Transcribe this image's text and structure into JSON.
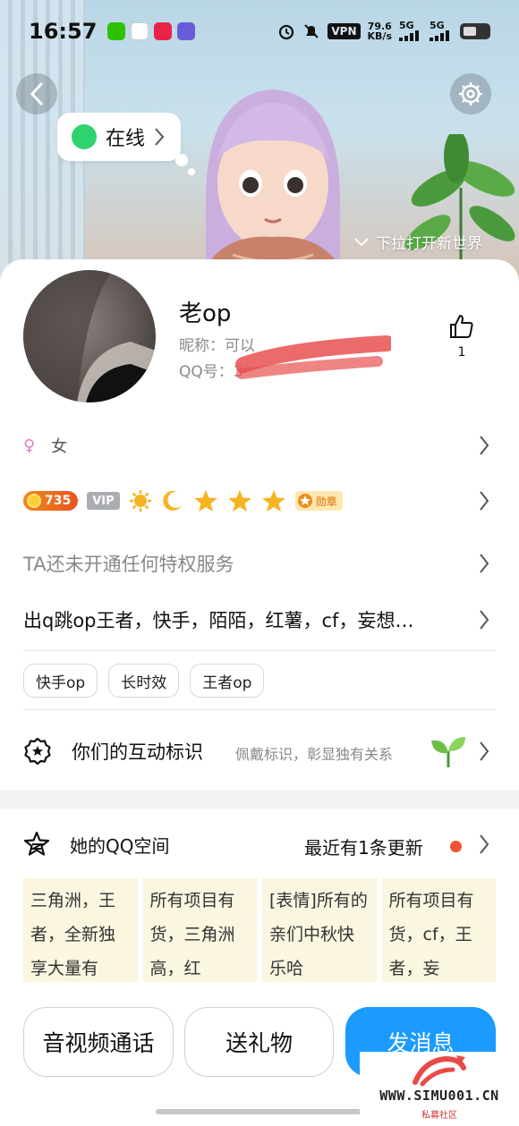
{
  "status_bar": {
    "time": "16:57",
    "vpn": "VPN",
    "speed_value": "79.6",
    "speed_unit": "KB/s",
    "sim1": "5G",
    "sim2": "5G"
  },
  "header": {
    "online_status": "在线",
    "pull_hint": "下拉打开新世界"
  },
  "profile": {
    "name": "老op",
    "nickname": "昵称：可以",
    "qq_number": "QQ号：3",
    "like_count": "1",
    "gender": "女"
  },
  "badges": {
    "level": "735",
    "vip": "VIP",
    "medal": "勋章"
  },
  "privilege_text": "TA还未开通任何特权服务",
  "bio": "出q跳op王者，快手，陌陌，红薯，cf，妄想…",
  "tags": [
    "快手op",
    "长时效",
    "王者op"
  ],
  "interaction": {
    "title": "你们的互动标识",
    "subtitle": "佩戴标识，彰显独有关系"
  },
  "qzone": {
    "title": "她的QQ空间",
    "update": "最近有1条更新",
    "posts": [
      "三角洲，王者，全新独享大量有",
      "所有项目有货，三角洲高，红书，…",
      "[表情]所有的亲们中秋快乐哈",
      "所有项目有货，cf，王者，妄想，…"
    ]
  },
  "actions": {
    "call": "音视频通话",
    "gift": "送礼物",
    "message": "发消息"
  },
  "watermark": {
    "site": "WWW.SIMU001.CN",
    "name": "私募社区"
  },
  "colors": {
    "accent": "#1b9bff",
    "online": "#2ed36e",
    "update_dot": "#ef5534"
  }
}
